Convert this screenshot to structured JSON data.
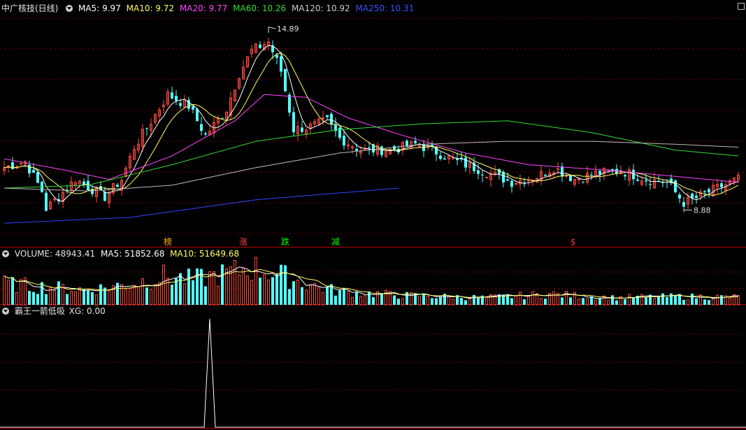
{
  "header": {
    "stock": "中广核技(日线)",
    "ma5": "MA5: 9.97",
    "ma10": "MA10: 9.72",
    "ma20": "MA20: 9.77",
    "ma60": "MA60: 10.26",
    "ma120": "MA120: 10.92",
    "ma250": "MA250: 10.31"
  },
  "volume_header": {
    "volume": "VOLUME: 48943.41",
    "ma5": "MA5: 51852.68",
    "ma10": "MA10: 51649.68"
  },
  "indicator_header": {
    "name": "霸王一箭低吸",
    "xg": "XG: 0.00"
  },
  "annotations": {
    "high": "14.89",
    "low": "8.88",
    "markers": [
      {
        "text": "榜",
        "index": 39,
        "color": "#ffb000"
      },
      {
        "text": "涨",
        "index": 57,
        "color": "#ff4040"
      },
      {
        "text": "跌",
        "index": 67,
        "color": "#00ff00"
      },
      {
        "text": "减",
        "index": 79,
        "color": "#00ff00"
      },
      {
        "text": "$",
        "index": 136,
        "color": "#ff3030"
      }
    ]
  },
  "colors": {
    "up": "#ff4a3d",
    "down": "#54ffff",
    "ma5": "#ffffff",
    "ma10": "#ffff66",
    "ma20": "#ff44ff",
    "ma60": "#33dd33",
    "ma120": "#bbbbbb",
    "ma250": "#3344ff",
    "grid": "#8a0000"
  },
  "chart_data": [
    {
      "type": "candlestick",
      "title": "中广核技(日线)",
      "ylim": [
        8.0,
        15.6
      ],
      "series_close_anchors": [
        {
          "i": 0,
          "v": 10.3
        },
        {
          "i": 5,
          "v": 10.5
        },
        {
          "i": 9,
          "v": 9.5
        },
        {
          "i": 10,
          "v": 8.9
        },
        {
          "i": 13,
          "v": 9.3
        },
        {
          "i": 17,
          "v": 9.9
        },
        {
          "i": 24,
          "v": 9.3
        },
        {
          "i": 28,
          "v": 9.9
        },
        {
          "i": 31,
          "v": 11.0
        },
        {
          "i": 36,
          "v": 12.1
        },
        {
          "i": 39,
          "v": 12.8
        },
        {
          "i": 44,
          "v": 12.4
        },
        {
          "i": 48,
          "v": 11.4
        },
        {
          "i": 53,
          "v": 12.3
        },
        {
          "i": 56,
          "v": 13.5
        },
        {
          "i": 59,
          "v": 14.3
        },
        {
          "i": 63,
          "v": 14.6
        },
        {
          "i": 66,
          "v": 13.6
        },
        {
          "i": 69,
          "v": 11.6
        },
        {
          "i": 73,
          "v": 11.7
        },
        {
          "i": 77,
          "v": 11.9
        },
        {
          "i": 80,
          "v": 11.3
        },
        {
          "i": 85,
          "v": 10.9
        },
        {
          "i": 92,
          "v": 10.9
        },
        {
          "i": 98,
          "v": 11.1
        },
        {
          "i": 102,
          "v": 10.9
        },
        {
          "i": 108,
          "v": 10.5
        },
        {
          "i": 114,
          "v": 10.2
        },
        {
          "i": 121,
          "v": 9.8
        },
        {
          "i": 127,
          "v": 10.0
        },
        {
          "i": 131,
          "v": 10.3
        },
        {
          "i": 136,
          "v": 9.9
        },
        {
          "i": 141,
          "v": 10.1
        },
        {
          "i": 147,
          "v": 10.2
        },
        {
          "i": 153,
          "v": 9.9
        },
        {
          "i": 158,
          "v": 9.8
        },
        {
          "i": 162,
          "v": 9.1
        },
        {
          "i": 164,
          "v": 9.2
        },
        {
          "i": 170,
          "v": 9.6
        },
        {
          "i": 175,
          "v": 9.9
        }
      ],
      "ma_anchors": {
        "MA20": [
          {
            "i": 0,
            "v": 10.6
          },
          {
            "i": 15,
            "v": 10.2
          },
          {
            "i": 25,
            "v": 9.9
          },
          {
            "i": 40,
            "v": 10.7
          },
          {
            "i": 55,
            "v": 11.9
          },
          {
            "i": 62,
            "v": 12.8
          },
          {
            "i": 72,
            "v": 12.7
          },
          {
            "i": 82,
            "v": 12.0
          },
          {
            "i": 95,
            "v": 11.4
          },
          {
            "i": 110,
            "v": 10.8
          },
          {
            "i": 125,
            "v": 10.4
          },
          {
            "i": 145,
            "v": 10.2
          },
          {
            "i": 160,
            "v": 10.0
          },
          {
            "i": 175,
            "v": 9.8
          }
        ],
        "MA60": [
          {
            "i": 0,
            "v": 9.6
          },
          {
            "i": 20,
            "v": 9.7
          },
          {
            "i": 40,
            "v": 10.4
          },
          {
            "i": 60,
            "v": 11.2
          },
          {
            "i": 80,
            "v": 11.6
          },
          {
            "i": 100,
            "v": 11.8
          },
          {
            "i": 120,
            "v": 11.9
          },
          {
            "i": 140,
            "v": 11.5
          },
          {
            "i": 160,
            "v": 10.9
          },
          {
            "i": 175,
            "v": 10.7
          }
        ],
        "MA120": [
          {
            "i": 0,
            "v": 9.6
          },
          {
            "i": 20,
            "v": 9.5
          },
          {
            "i": 40,
            "v": 9.7
          },
          {
            "i": 60,
            "v": 10.3
          },
          {
            "i": 80,
            "v": 10.8
          },
          {
            "i": 100,
            "v": 11.1
          },
          {
            "i": 120,
            "v": 11.2
          },
          {
            "i": 140,
            "v": 11.2
          },
          {
            "i": 160,
            "v": 11.1
          },
          {
            "i": 175,
            "v": 11.0
          }
        ],
        "MA250": [
          {
            "i": 0,
            "v": 8.4
          },
          {
            "i": 30,
            "v": 8.6
          },
          {
            "i": 60,
            "v": 9.2
          },
          {
            "i": 94,
            "v": 9.6
          }
        ]
      }
    },
    {
      "type": "bar",
      "title": "VOLUME",
      "ylim": [
        0,
        80000
      ],
      "volume_anchors": [
        {
          "i": 0,
          "v": 35000
        },
        {
          "i": 10,
          "v": 30000
        },
        {
          "i": 20,
          "v": 25000
        },
        {
          "i": 30,
          "v": 35000
        },
        {
          "i": 38,
          "v": 48000
        },
        {
          "i": 45,
          "v": 42000
        },
        {
          "i": 55,
          "v": 55000
        },
        {
          "i": 58,
          "v": 63000
        },
        {
          "i": 62,
          "v": 58000
        },
        {
          "i": 66,
          "v": 50000
        },
        {
          "i": 72,
          "v": 35000
        },
        {
          "i": 80,
          "v": 22000
        },
        {
          "i": 95,
          "v": 16000
        },
        {
          "i": 115,
          "v": 12000
        },
        {
          "i": 130,
          "v": 18000
        },
        {
          "i": 145,
          "v": 12000
        },
        {
          "i": 160,
          "v": 14000
        },
        {
          "i": 175,
          "v": 13000
        }
      ]
    },
    {
      "type": "line",
      "title": "霸王一箭低吸",
      "ylim": [
        0,
        1
      ],
      "signal_index": 49,
      "xg_value": 0.0
    }
  ]
}
